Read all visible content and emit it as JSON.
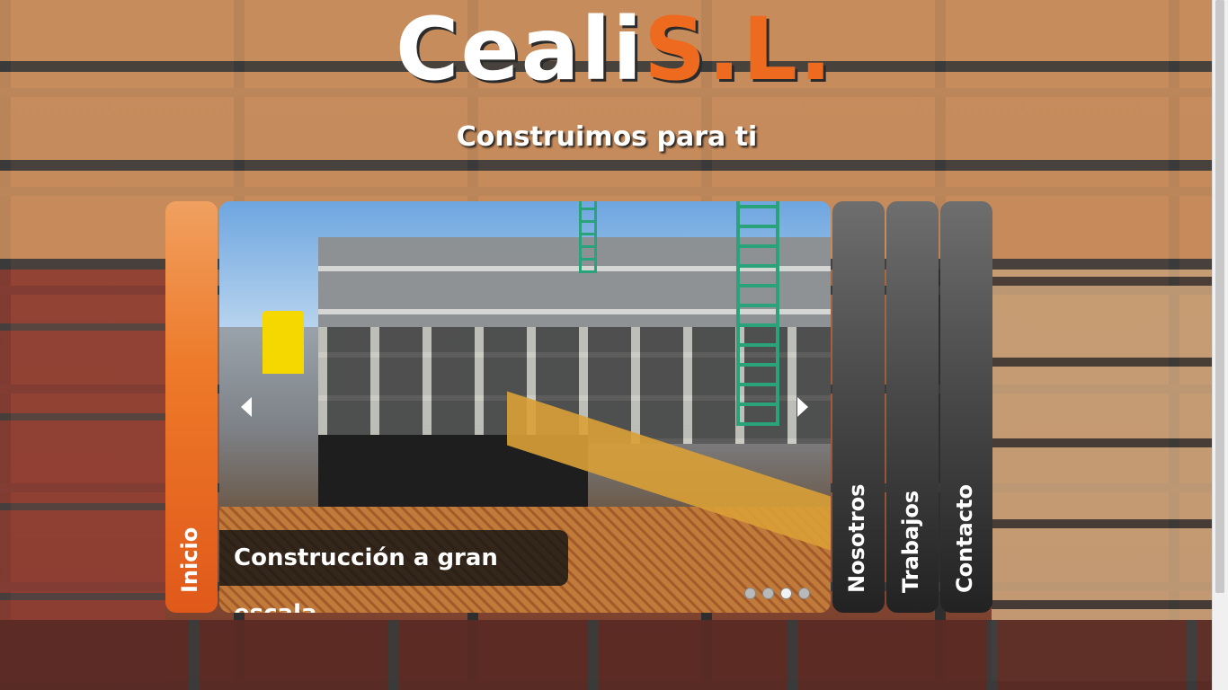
{
  "brand": {
    "name_part1": "Ceali",
    "name_part2": "S.L.",
    "tagline": "Construimos para ti",
    "accent_color": "#ee6a1f"
  },
  "nav": {
    "active": "Inicio",
    "items": [
      "Inicio",
      "Nosotros",
      "Trabajos",
      "Contacto"
    ]
  },
  "slider": {
    "caption": "Construcción a gran escala",
    "prev_icon": "triangle-left-icon",
    "next_icon": "triangle-right-icon",
    "dots": 4,
    "active_dot": 3
  }
}
